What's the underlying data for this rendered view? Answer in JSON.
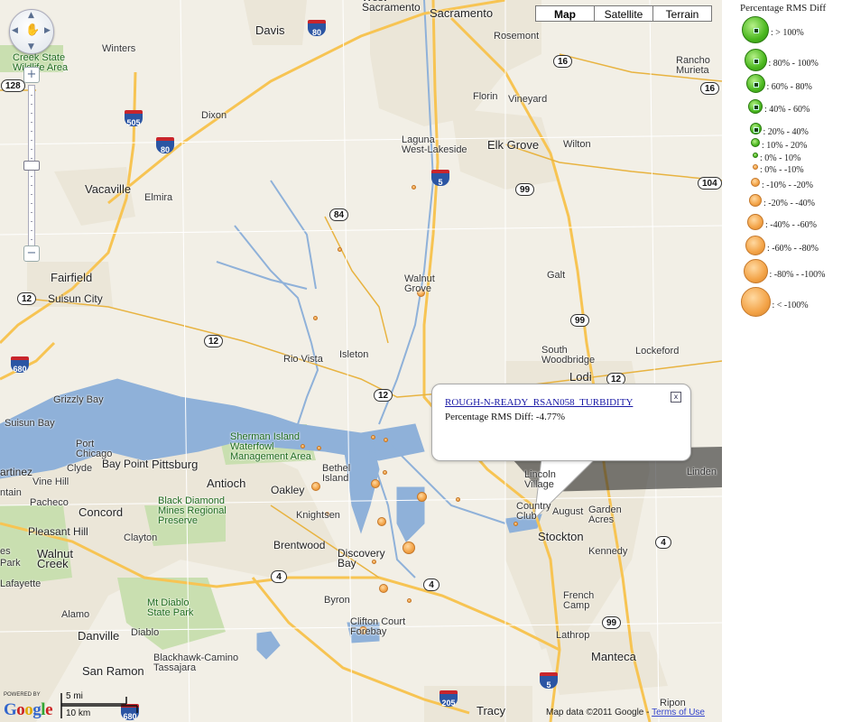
{
  "map": {
    "map_type_buttons": [
      {
        "label": "Map",
        "active": true
      },
      {
        "label": "Satellite",
        "active": false
      },
      {
        "label": "Terrain",
        "active": false
      }
    ],
    "zoom_in_label": "+",
    "zoom_out_label": "−",
    "places": [
      {
        "id": "west-sacramento",
        "name": "West\nSacramento",
        "class": "city"
      },
      {
        "id": "sacramento",
        "name": "Sacramento",
        "class": "big"
      },
      {
        "id": "davis",
        "name": "Davis",
        "class": "big"
      },
      {
        "id": "rosemont",
        "name": "Rosemont",
        "class": ""
      },
      {
        "id": "winters",
        "name": "Winters",
        "class": ""
      },
      {
        "id": "creek-state",
        "name": "Creek State\nWildlife Area",
        "class": "green"
      },
      {
        "id": "florin",
        "name": "Florin",
        "class": ""
      },
      {
        "id": "rancho-murieta",
        "name": "Rancho\nMurieta",
        "class": ""
      },
      {
        "id": "dixon",
        "name": "Dixon",
        "class": ""
      },
      {
        "id": "vineyard",
        "name": "Vineyard",
        "class": ""
      },
      {
        "id": "laguna",
        "name": "Laguna\nWest-Lakeside",
        "class": ""
      },
      {
        "id": "elk-grove",
        "name": "Elk Grove",
        "class": "big"
      },
      {
        "id": "wilton",
        "name": "Wilton",
        "class": ""
      },
      {
        "id": "vacaville",
        "name": "Vacaville",
        "class": "big"
      },
      {
        "id": "elmira",
        "name": "Elmira",
        "class": ""
      },
      {
        "id": "walnut-grove",
        "name": "Walnut\nGrove",
        "class": ""
      },
      {
        "id": "galt",
        "name": "Galt",
        "class": ""
      },
      {
        "id": "fairfield",
        "name": "Fairfield",
        "class": "big"
      },
      {
        "id": "suisun-city",
        "name": "Suisun City",
        "class": "city"
      },
      {
        "id": "rio-vista",
        "name": "Rio Vista",
        "class": ""
      },
      {
        "id": "isleton",
        "name": "Isleton",
        "class": ""
      },
      {
        "id": "south-woodbridge",
        "name": "South\nWoodbridge",
        "class": ""
      },
      {
        "id": "lockeford",
        "name": "Lockeford",
        "class": ""
      },
      {
        "id": "lodi",
        "name": "Lodi",
        "class": "big"
      },
      {
        "id": "grizzly-bay",
        "name": "Grizzly Bay",
        "class": ""
      },
      {
        "id": "suisun-bay",
        "name": "Suisun Bay",
        "class": ""
      },
      {
        "id": "port-chicago",
        "name": "Port\nChicago",
        "class": ""
      },
      {
        "id": "sherman-island",
        "name": "Sherman Island\nWaterfowl\nManagement Area",
        "class": "green"
      },
      {
        "id": "martinez",
        "name": "artinez",
        "class": "city"
      },
      {
        "id": "clyde",
        "name": "Clyde",
        "class": ""
      },
      {
        "id": "bay-point",
        "name": "Bay Point",
        "class": "city"
      },
      {
        "id": "pittsburg",
        "name": "Pittsburg",
        "class": "big"
      },
      {
        "id": "bethel-island",
        "name": "Bethel\nIsland",
        "class": ""
      },
      {
        "id": "lincoln-village",
        "name": "Lincoln\nVillage",
        "class": ""
      },
      {
        "id": "linden",
        "name": "Linden",
        "class": ""
      },
      {
        "id": "vine-hill",
        "name": "Vine Hill",
        "class": ""
      },
      {
        "id": "mountain",
        "name": "ntain",
        "class": ""
      },
      {
        "id": "antioch",
        "name": "Antioch",
        "class": "big"
      },
      {
        "id": "oakley",
        "name": "Oakley",
        "class": "city"
      },
      {
        "id": "country-club",
        "name": "Country\nClub",
        "class": ""
      },
      {
        "id": "august",
        "name": "August",
        "class": ""
      },
      {
        "id": "garden-acres",
        "name": "Garden\nAcres",
        "class": ""
      },
      {
        "id": "pacheco",
        "name": "Pacheco",
        "class": ""
      },
      {
        "id": "black-diamond",
        "name": "Black Diamond\nMines Regional\nPreserve",
        "class": "green"
      },
      {
        "id": "knightsen",
        "name": "Knightsen",
        "class": ""
      },
      {
        "id": "concord",
        "name": "Concord",
        "class": "big"
      },
      {
        "id": "stockton",
        "name": "Stockton",
        "class": "big"
      },
      {
        "id": "pleasant-hill",
        "name": "Pleasant Hill",
        "class": "city"
      },
      {
        "id": "clayton",
        "name": "Clayton",
        "class": ""
      },
      {
        "id": "brentwood",
        "name": "Brentwood",
        "class": "city"
      },
      {
        "id": "kennedy",
        "name": "Kennedy",
        "class": ""
      },
      {
        "id": "walnut-creek",
        "name": "Walnut\nCreek",
        "class": "big"
      },
      {
        "id": "discovery-bay",
        "name": "Discovery\nBay",
        "class": "city"
      },
      {
        "id": "es",
        "name": "es",
        "class": ""
      },
      {
        "id": "park",
        "name": "Park",
        "class": ""
      },
      {
        "id": "lafayette",
        "name": "Lafayette",
        "class": ""
      },
      {
        "id": "french-camp",
        "name": "French\nCamp",
        "class": ""
      },
      {
        "id": "byron",
        "name": "Byron",
        "class": ""
      },
      {
        "id": "mt-diablo",
        "name": "Mt Diablo\nState Park",
        "class": "green"
      },
      {
        "id": "alamo",
        "name": "Alamo",
        "class": ""
      },
      {
        "id": "clifton-court",
        "name": "Clifton Court\nForebay",
        "class": ""
      },
      {
        "id": "diablo",
        "name": "Diablo",
        "class": ""
      },
      {
        "id": "lathrop",
        "name": "Lathrop",
        "class": ""
      },
      {
        "id": "danville",
        "name": "Danville",
        "class": "big"
      },
      {
        "id": "manteca",
        "name": "Manteca",
        "class": "big"
      },
      {
        "id": "blackhawk",
        "name": "Blackhawk-Camino\nTassajara",
        "class": ""
      },
      {
        "id": "san-ramon",
        "name": "San Ramon",
        "class": "big"
      },
      {
        "id": "tracy",
        "name": "Tracy",
        "class": "big"
      },
      {
        "id": "ripon",
        "name": "Ripon",
        "class": ""
      }
    ],
    "shields": [
      {
        "id": "sr16-a",
        "label": "16"
      },
      {
        "id": "sr16-b",
        "label": "16"
      },
      {
        "id": "sr128",
        "label": "128"
      },
      {
        "id": "sr104",
        "label": "104"
      },
      {
        "id": "sr99-a",
        "label": "99"
      },
      {
        "id": "sr84",
        "label": "84"
      },
      {
        "id": "sr12-a",
        "label": "12"
      },
      {
        "id": "sr12-b",
        "label": "12"
      },
      {
        "id": "sr12-c",
        "label": "12"
      },
      {
        "id": "sr12-d",
        "label": "12"
      },
      {
        "id": "sr99-b",
        "label": "99"
      },
      {
        "id": "sr4-a",
        "label": "4"
      },
      {
        "id": "sr4-b",
        "label": "4"
      },
      {
        "id": "sr4-c",
        "label": "4"
      },
      {
        "id": "sr99-c",
        "label": "99"
      }
    ],
    "interstates": [
      {
        "id": "i80-a",
        "label": "80"
      },
      {
        "id": "i505",
        "label": "505"
      },
      {
        "id": "i80-b",
        "label": "80"
      },
      {
        "id": "i5-a",
        "label": "5"
      },
      {
        "id": "i680-a",
        "label": "680"
      },
      {
        "id": "i5-b",
        "label": "5"
      },
      {
        "id": "i205",
        "label": "205"
      },
      {
        "id": "i680-b",
        "label": "680"
      }
    ],
    "info_window": {
      "station": "ROUGH-N-READY_RSAN058_TURBIDITY",
      "value_text": "Percentage RMS Diff: -4.77%",
      "close_label": "x"
    },
    "footer": {
      "powered_by": "POWERED BY",
      "logo_text": "Google",
      "scale_mi": "5 mi",
      "scale_km": "10 km",
      "copyright": "Map data ©2011 Google - ",
      "terms": "Terms of Use"
    }
  },
  "legend": {
    "title": "Percentage RMS Diff",
    "items": [
      {
        "label": ": > 100%",
        "kind": "green",
        "size": 30
      },
      {
        "label": ": 80% - 100%",
        "kind": "green",
        "size": 25
      },
      {
        "label": ": 60% - 80%",
        "kind": "green",
        "size": 21
      },
      {
        "label": ": 40% - 60%",
        "kind": "green",
        "size": 16
      },
      {
        "label": ": 20% - 40%",
        "kind": "green",
        "size": 13
      },
      {
        "label": ": 10% - 20%",
        "kind": "green",
        "size": 10
      },
      {
        "label": ": 0% - 10%",
        "kind": "green",
        "size": 6
      },
      {
        "label": ": 0% - -10%",
        "kind": "orange",
        "size": 6
      },
      {
        "label": ": -10% - -20%",
        "kind": "orange",
        "size": 10
      },
      {
        "label": ": -20% - -40%",
        "kind": "orange",
        "size": 14
      },
      {
        "label": ": -40% - -60%",
        "kind": "orange",
        "size": 18
      },
      {
        "label": ": -60% - -80%",
        "kind": "orange",
        "size": 22
      },
      {
        "label": ": -80% - -100%",
        "kind": "orange",
        "size": 27
      },
      {
        "label": ": < -100%",
        "kind": "orange",
        "size": 33
      }
    ]
  },
  "colors": {
    "land": "#f2efe6",
    "water": "#8fb1d9",
    "park": "#c9dfb0",
    "urban": "#ebe6d8",
    "highway": "#f7c453",
    "road": "#ffffff",
    "green_marker": "#4bb81f",
    "orange_marker": "#f3a347"
  }
}
